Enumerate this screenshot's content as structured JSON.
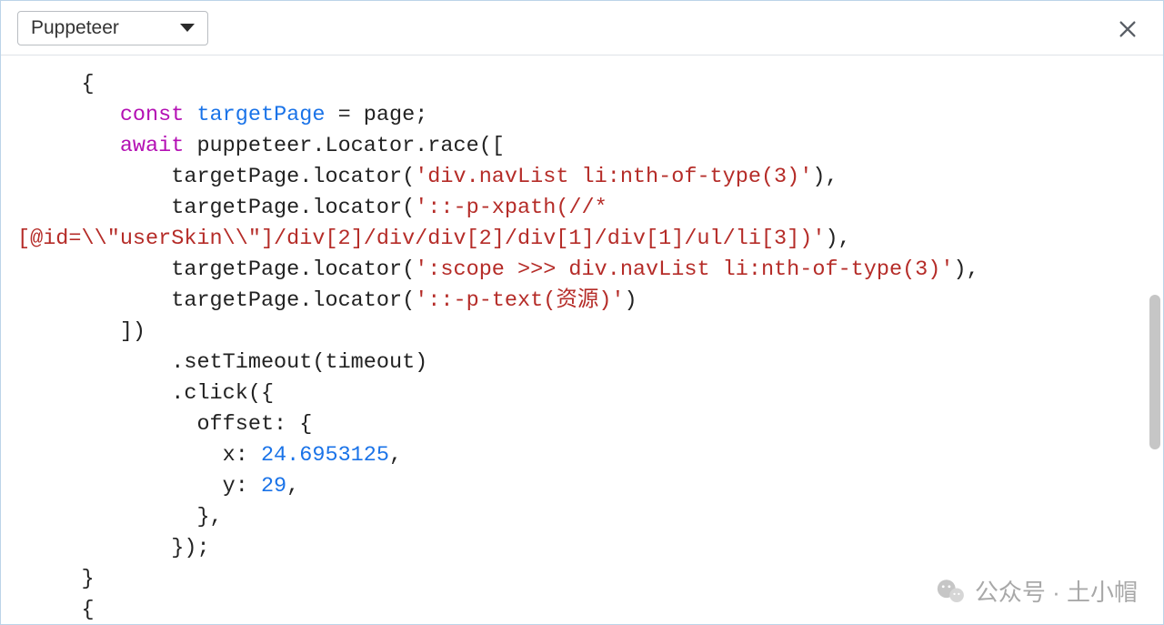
{
  "toolbar": {
    "selector_value": "Puppeteer",
    "close_icon": "close"
  },
  "code": {
    "block": {
      "open_brace": "{",
      "l1": {
        "kw": "const",
        "varname": "targetPage",
        "rest": " = page;"
      },
      "l2": {
        "kw": "await",
        "rest": " puppeteer.Locator.race(["
      },
      "loc1": {
        "prefix": "targetPage.locator(",
        "str": "'div.navList li:nth-of-type(3)'",
        "suffix": "),"
      },
      "loc2": {
        "prefix": "targetPage.locator(",
        "str_a": "'::-p-xpath(//*",
        "str_b": "[@id=\\\\\"userSkin\\\\\"]/div[2]/div/div[2]/div[1]/div[1]/ul/li[3])'",
        "suffix": "),"
      },
      "loc3": {
        "prefix": "targetPage.locator(",
        "str": "':scope >>> div.navList li:nth-of-type(3)'",
        "suffix": "),"
      },
      "loc4": {
        "prefix": "targetPage.locator(",
        "str": "'::-p-text(资源)'",
        "suffix": ")"
      },
      "close_array": "])",
      "setTimeout_line": ".setTimeout(timeout)",
      "click_open": ".click({",
      "offset_label": "offset: {",
      "x_line": {
        "label": "x: ",
        "val": "24.6953125",
        "tail": ","
      },
      "y_line": {
        "label": "y: ",
        "val": "29",
        "tail": ","
      },
      "offset_close": "},",
      "click_close": "});",
      "close_brace": "}",
      "next_open": "{"
    }
  },
  "watermark": {
    "text": "公众号 · 土小帽"
  }
}
